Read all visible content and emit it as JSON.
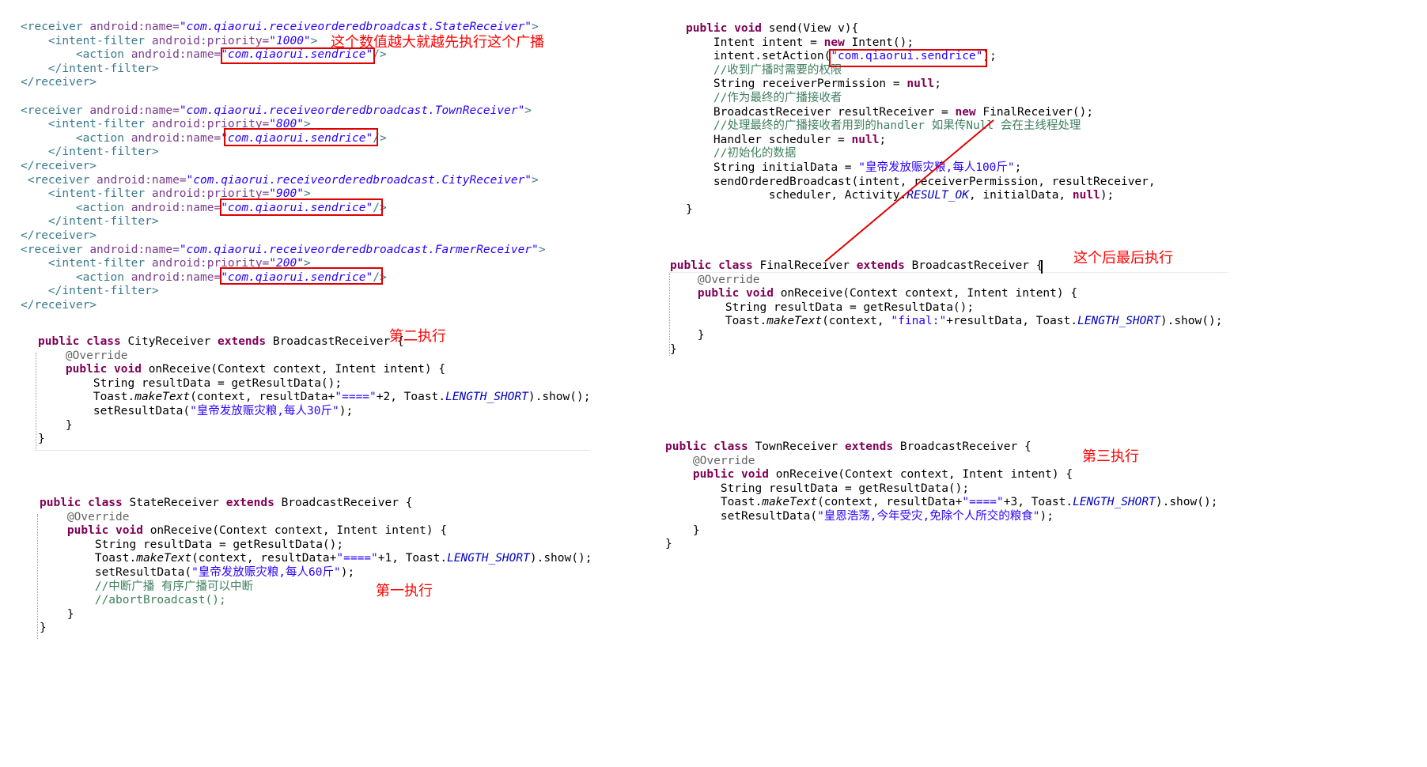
{
  "xml_block": {
    "lines": [
      [
        [
          "tag",
          "<receiver "
        ],
        [
          "attr",
          "android:name="
        ],
        [
          "val",
          "\"com.qiaorui.receiveorderedbroadcast.StateReceiver\""
        ],
        [
          "tag",
          ">"
        ]
      ],
      [
        [
          "plain",
          "    "
        ],
        [
          "tag",
          "<intent-filter "
        ],
        [
          "attr",
          "android:priority="
        ],
        [
          "val",
          "\"1000\""
        ],
        [
          "tag",
          ">"
        ]
      ],
      [
        [
          "plain",
          "        "
        ],
        [
          "tag",
          "<action "
        ],
        [
          "attr",
          "android:name="
        ],
        [
          "val",
          "\"com.qiaorui.sendrice\""
        ],
        [
          "tag",
          "/>"
        ]
      ],
      [
        [
          "plain",
          "    "
        ],
        [
          "tag",
          "</intent-filter>"
        ]
      ],
      [
        [
          "tag",
          "</receiver>"
        ]
      ],
      [
        [
          "plain",
          ""
        ]
      ],
      [
        [
          "tag",
          "<receiver "
        ],
        [
          "attr",
          "android:name="
        ],
        [
          "val",
          "\"com.qiaorui.receiveorderedbroadcast.TownReceiver\""
        ],
        [
          "tag",
          ">"
        ]
      ],
      [
        [
          "plain",
          "    "
        ],
        [
          "tag",
          "<intent-filter "
        ],
        [
          "attr",
          "android:priority="
        ],
        [
          "val",
          "\"800\""
        ],
        [
          "tag",
          ">"
        ]
      ],
      [
        [
          "plain",
          "        "
        ],
        [
          "tag",
          "<action "
        ],
        [
          "attr",
          "android:name="
        ],
        [
          "val",
          "\"com.qiaorui.sendrice\""
        ],
        [
          "tag",
          "/>"
        ]
      ],
      [
        [
          "plain",
          "    "
        ],
        [
          "tag",
          "</intent-filter>"
        ]
      ],
      [
        [
          "tag",
          "</receiver>"
        ]
      ],
      [
        [
          "plain",
          " "
        ],
        [
          "tag",
          "<receiver "
        ],
        [
          "attr",
          "android:name="
        ],
        [
          "val",
          "\"com.qiaorui.receiveorderedbroadcast.CityReceiver\""
        ],
        [
          "tag",
          ">"
        ]
      ],
      [
        [
          "plain",
          "    "
        ],
        [
          "tag",
          "<intent-filter "
        ],
        [
          "attr",
          "android:priority="
        ],
        [
          "val",
          "\"900\""
        ],
        [
          "tag",
          ">"
        ]
      ],
      [
        [
          "plain",
          "        "
        ],
        [
          "tag",
          "<action "
        ],
        [
          "attr",
          "android:name="
        ],
        [
          "val",
          "\"com.qiaorui.sendrice\""
        ],
        [
          "tag",
          "/>"
        ]
      ],
      [
        [
          "plain",
          "    "
        ],
        [
          "tag",
          "</intent-filter>"
        ]
      ],
      [
        [
          "tag",
          "</receiver>"
        ]
      ],
      [
        [
          "tag",
          "<receiver "
        ],
        [
          "attr",
          "android:name="
        ],
        [
          "val",
          "\"com.qiaorui.receiveorderedbroadcast.FarmerReceiver\""
        ],
        [
          "tag",
          ">"
        ]
      ],
      [
        [
          "plain",
          "    "
        ],
        [
          "tag",
          "<intent-filter "
        ],
        [
          "attr",
          "android:priority="
        ],
        [
          "val",
          "\"200\""
        ],
        [
          "tag",
          ">"
        ]
      ],
      [
        [
          "plain",
          "        "
        ],
        [
          "tag",
          "<action "
        ],
        [
          "attr",
          "android:name="
        ],
        [
          "val",
          "\"com.qiaorui.sendrice\""
        ],
        [
          "tag",
          "/>"
        ]
      ],
      [
        [
          "plain",
          "    "
        ],
        [
          "tag",
          "</intent-filter>"
        ]
      ],
      [
        [
          "tag",
          "</receiver>"
        ]
      ]
    ]
  },
  "city_block": {
    "lines": [
      [
        [
          "kw",
          "public class "
        ],
        [
          "plain",
          "CityReceiver "
        ],
        [
          "kw",
          "extends "
        ],
        [
          "plain",
          "BroadcastReceiver {"
        ]
      ],
      [
        [
          "plain",
          "    "
        ],
        [
          "ann",
          "@Override"
        ]
      ],
      [
        [
          "plain",
          "    "
        ],
        [
          "kw",
          "public void "
        ],
        [
          "plain",
          "onReceive(Context context, Intent intent) {"
        ]
      ],
      [
        [
          "plain",
          "        String resultData = getResultData();"
        ]
      ],
      [
        [
          "plain",
          "        Toast."
        ],
        [
          "ital",
          "makeText"
        ],
        [
          "plain",
          "(context, resultData+"
        ],
        [
          "str",
          "\"====\""
        ],
        [
          "plain",
          "+2, Toast."
        ],
        [
          "const",
          "LENGTH_SHORT"
        ],
        [
          "plain",
          ").show();"
        ]
      ],
      [
        [
          "plain",
          "        setResultData("
        ],
        [
          "str",
          "\"皇帝发放赈灾粮,每人30斤\""
        ],
        [
          "plain",
          ");"
        ]
      ],
      [
        [
          "plain",
          "    }"
        ]
      ],
      [
        [
          "plain",
          "}"
        ]
      ]
    ]
  },
  "state_block": {
    "lines": [
      [
        [
          "kw",
          "public class "
        ],
        [
          "plain",
          "StateReceiver "
        ],
        [
          "kw",
          "extends "
        ],
        [
          "plain",
          "BroadcastReceiver {"
        ]
      ],
      [
        [
          "plain",
          "    "
        ],
        [
          "ann",
          "@Override"
        ]
      ],
      [
        [
          "plain",
          "    "
        ],
        [
          "kw",
          "public void "
        ],
        [
          "plain",
          "onReceive(Context context, Intent intent) {"
        ]
      ],
      [
        [
          "plain",
          "        String resultData = getResultData();"
        ]
      ],
      [
        [
          "plain",
          "        Toast."
        ],
        [
          "ital",
          "makeText"
        ],
        [
          "plain",
          "(context, resultData+"
        ],
        [
          "str",
          "\"====\""
        ],
        [
          "plain",
          "+1, Toast."
        ],
        [
          "const",
          "LENGTH_SHORT"
        ],
        [
          "plain",
          ").show();"
        ]
      ],
      [
        [
          "plain",
          "        setResultData("
        ],
        [
          "str",
          "\"皇帝发放赈灾粮,每人60斤\""
        ],
        [
          "plain",
          ");"
        ]
      ],
      [
        [
          "plain",
          "        "
        ],
        [
          "com",
          "//中断广播 有序广播可以中断"
        ]
      ],
      [
        [
          "plain",
          "        "
        ],
        [
          "com",
          "//abortBroadcast();"
        ]
      ],
      [
        [
          "plain",
          "    }"
        ]
      ],
      [
        [
          "plain",
          "}"
        ]
      ]
    ]
  },
  "send_block": {
    "lines": [
      [
        [
          "kw",
          "public void "
        ],
        [
          "plain",
          "send(View v){"
        ]
      ],
      [
        [
          "plain",
          "    Intent intent = "
        ],
        [
          "kw",
          "new "
        ],
        [
          "plain",
          "Intent();"
        ]
      ],
      [
        [
          "plain",
          "    intent.setAction("
        ],
        [
          "str",
          "\"com.qiaorui.sendrice\""
        ],
        [
          "plain",
          ");"
        ]
      ],
      [
        [
          "plain",
          "    "
        ],
        [
          "com",
          "//收到广播时需要的权限"
        ]
      ],
      [
        [
          "plain",
          "    String receiverPermission = "
        ],
        [
          "kw",
          "null"
        ],
        [
          "plain",
          ";"
        ]
      ],
      [
        [
          "plain",
          "    "
        ],
        [
          "com",
          "//作为最终的广播接收者"
        ]
      ],
      [
        [
          "plain",
          "    BroadcastReceiver resultReceiver = "
        ],
        [
          "kw",
          "new "
        ],
        [
          "plain",
          "FinalReceiver();"
        ]
      ],
      [
        [
          "plain",
          "    "
        ],
        [
          "com",
          "//处理最终的广播接收者用到的handler 如果传Null 会在主线程处理"
        ]
      ],
      [
        [
          "plain",
          "    Handler scheduler = "
        ],
        [
          "kw",
          "null"
        ],
        [
          "plain",
          ";"
        ]
      ],
      [
        [
          "plain",
          "    "
        ],
        [
          "com",
          "//初始化的数据"
        ]
      ],
      [
        [
          "plain",
          "    String initialData = "
        ],
        [
          "str",
          "\"皇帝发放赈灾粮,每人100斤\""
        ],
        [
          "plain",
          ";"
        ]
      ],
      [
        [
          "plain",
          "    sendOrderedBroadcast(intent, receiverPermission, resultReceiver,"
        ]
      ],
      [
        [
          "plain",
          "            scheduler, Activity."
        ],
        [
          "const",
          "RESULT_OK"
        ],
        [
          "plain",
          ", initialData, "
        ],
        [
          "kw",
          "null"
        ],
        [
          "plain",
          ");"
        ]
      ],
      [
        [
          "plain",
          "}"
        ]
      ]
    ]
  },
  "final_block": {
    "lines": [
      [
        [
          "kw",
          "public class "
        ],
        [
          "plain",
          "FinalReceiver "
        ],
        [
          "kw",
          "extends "
        ],
        [
          "plain",
          "BroadcastReceiver {"
        ]
      ],
      [
        [
          "plain",
          "    "
        ],
        [
          "ann",
          "@Override"
        ]
      ],
      [
        [
          "plain",
          "    "
        ],
        [
          "kw",
          "public void "
        ],
        [
          "plain",
          "onReceive(Context context, Intent intent) {"
        ]
      ],
      [
        [
          "plain",
          "        String resultData = getResultData();"
        ]
      ],
      [
        [
          "plain",
          "        Toast."
        ],
        [
          "ital",
          "makeText"
        ],
        [
          "plain",
          "(context, "
        ],
        [
          "str",
          "\"final:\""
        ],
        [
          "plain",
          "+resultData, Toast."
        ],
        [
          "const",
          "LENGTH_SHORT"
        ],
        [
          "plain",
          ").show();"
        ]
      ],
      [
        [
          "plain",
          "    }"
        ]
      ],
      [
        [
          "plain",
          "}"
        ]
      ]
    ]
  },
  "town_block": {
    "lines": [
      [
        [
          "kw",
          "public class "
        ],
        [
          "plain",
          "TownReceiver "
        ],
        [
          "kw",
          "extends "
        ],
        [
          "plain",
          "BroadcastReceiver {"
        ]
      ],
      [
        [
          "plain",
          "    "
        ],
        [
          "ann",
          "@Override"
        ]
      ],
      [
        [
          "plain",
          "    "
        ],
        [
          "kw",
          "public void "
        ],
        [
          "plain",
          "onReceive(Context context, Intent intent) {"
        ]
      ],
      [
        [
          "plain",
          "        String resultData = getResultData();"
        ]
      ],
      [
        [
          "plain",
          "        Toast."
        ],
        [
          "ital",
          "makeText"
        ],
        [
          "plain",
          "(context, resultData+"
        ],
        [
          "str",
          "\"====\""
        ],
        [
          "plain",
          "+3, Toast."
        ],
        [
          "const",
          "LENGTH_SHORT"
        ],
        [
          "plain",
          ").show();"
        ]
      ],
      [
        [
          "plain",
          "        setResultData("
        ],
        [
          "str",
          "\"皇恩浩荡,今年受灾,免除个人所交的粮食\""
        ],
        [
          "plain",
          ");"
        ]
      ],
      [
        [
          "plain",
          "    }"
        ]
      ],
      [
        [
          "plain",
          "}"
        ]
      ]
    ]
  },
  "annotations": {
    "priority_note": "这个数值越大就越先执行这个广播",
    "second": "第二执行",
    "first": "第一执行",
    "final_last": "这个后最后执行",
    "third": "第三执行"
  },
  "colors": {
    "annotation": "#ff0000",
    "box": "#e00000",
    "keyword": "#7f0055",
    "string": "#2a00ff",
    "comment": "#3f7f5f"
  }
}
